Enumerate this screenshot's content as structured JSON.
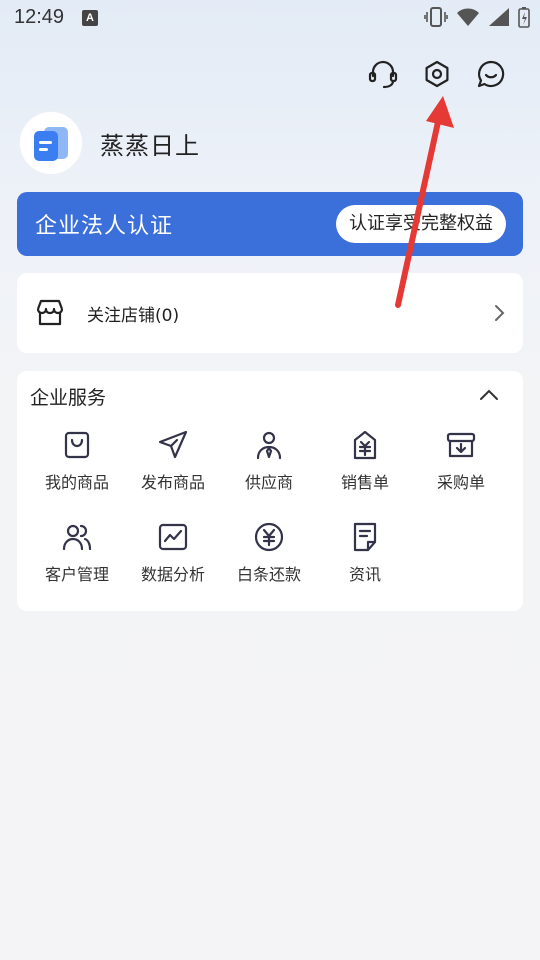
{
  "status_bar": {
    "time": "12:49",
    "notification_letter": "A"
  },
  "top_icons": [
    {
      "name": "customer-service-icon"
    },
    {
      "name": "settings-icon"
    },
    {
      "name": "message-icon"
    }
  ],
  "profile": {
    "name": "蒸蒸日上"
  },
  "certification": {
    "title": "企业法人认证",
    "action": "认证享受完整权益"
  },
  "store": {
    "label": "关注店铺(0)"
  },
  "services": {
    "title": "企业服务",
    "items": [
      {
        "label": "我的商品",
        "icon": "shopping-bag-icon"
      },
      {
        "label": "发布商品",
        "icon": "send-icon"
      },
      {
        "label": "供应商",
        "icon": "supplier-person-icon"
      },
      {
        "label": "销售单",
        "icon": "sales-tag-icon"
      },
      {
        "label": "采购单",
        "icon": "purchase-box-icon"
      },
      {
        "label": "客户管理",
        "icon": "users-icon"
      },
      {
        "label": "数据分析",
        "icon": "chart-icon"
      },
      {
        "label": "白条还款",
        "icon": "yuan-coin-icon"
      },
      {
        "label": "资讯",
        "icon": "news-doc-icon"
      }
    ]
  },
  "colors": {
    "accent": "#3b6fd9",
    "annotation_arrow": "#e53935"
  }
}
